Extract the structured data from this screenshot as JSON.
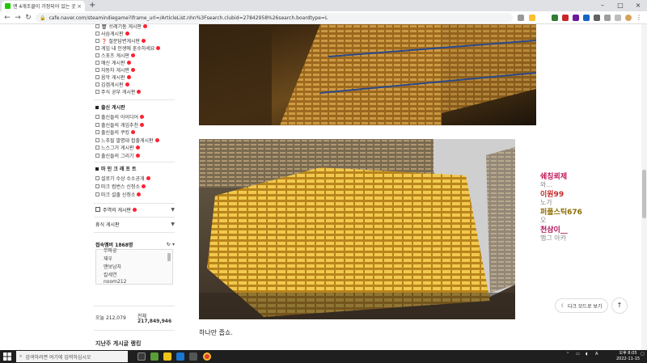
{
  "browser": {
    "tab_title": "앤 4개조클이 가정되어 있는 곳",
    "tab_close": "×",
    "new_tab": "+",
    "url": "cafe.naver.com/steamindiegame?iframe_url=/ArticleList.nhn%3Fsearch.clubid=27842958%26search.boardtype=L",
    "win_min": "–",
    "win_max": "□",
    "win_close": "×"
  },
  "sidebar": {
    "menu_top": [
      {
        "label": "🗑 쓰레기통 게시판"
      },
      {
        "label": "사슴게시판"
      },
      {
        "label": "❓ 질문답변게시판"
      },
      {
        "label": "게임 내 인생에 훈수하세요"
      },
      {
        "label": "스포츠 게시판"
      },
      {
        "label": "애신 게시판"
      },
      {
        "label": "자동차 게시판"
      },
      {
        "label": "음악 게시판"
      },
      {
        "label": "김겜게시판"
      },
      {
        "label": "주식 공부 게시판"
      }
    ],
    "section_fan_title": "출신 게시판",
    "section_fan": [
      {
        "label": "출신들의 아이디어"
      },
      {
        "label": "출신들의 게임추천"
      },
      {
        "label": "출신들의 쿠킹"
      },
      {
        "label": "느추될 발명대 접출게시판"
      },
      {
        "label": "느스그거 게시판"
      },
      {
        "label": "출신들의 그리기"
      }
    ],
    "section_market_title": "마 인 크 래 프 트",
    "section_market": [
      {
        "label": "설로기 수상 수소공개"
      },
      {
        "label": "마크 컴번스 신청소"
      },
      {
        "label": "마크 설출 신청소"
      }
    ],
    "fold_1": "주역의 게시판",
    "fold_2": "휴식 게시판",
    "members_label": "접속멤버 1868명",
    "members": [
      "무파궁",
      "재우",
      "맨보남자",
      "칼세연",
      "noom212"
    ],
    "stat_today_label": "오늘 212,079",
    "stat_total_label": "전체",
    "stat_total_value": "217,849,946",
    "bottom_label": "지난주 게시글 랭킹"
  },
  "content": {
    "caption": "하나만 줍쇼."
  },
  "chat": [
    {
      "nick": "쉐칭뢰제",
      "msg": "와...",
      "color": "#c2185b"
    },
    {
      "nick": "이원99",
      "msg": "노가",
      "color": "#c62828"
    },
    {
      "nick": "퍼플스틱676",
      "msg": "오",
      "color": "#8d6e00"
    },
    {
      "nick": "천삼이__",
      "msg": "행그 아카",
      "color": "#ad1457"
    }
  ],
  "floating": {
    "darkmode": "다크 모드로 보기",
    "top": "↑"
  },
  "taskbar": {
    "search_placeholder": "검색하려면 여기에 입력하십시오",
    "time": "오후 8:05",
    "date": "2022-11-15"
  }
}
